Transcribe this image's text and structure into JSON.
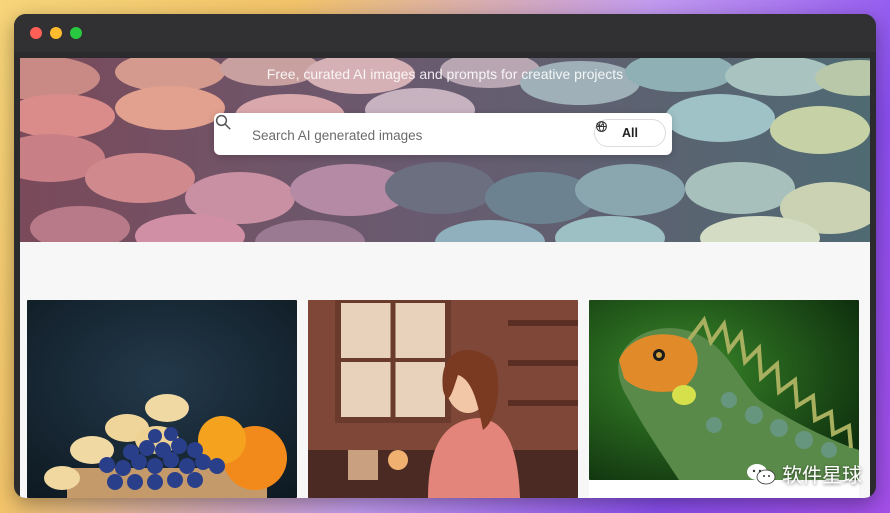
{
  "hero": {
    "tagline": "Free, curated AI images and prompts for creative projects"
  },
  "search": {
    "placeholder": "Search AI generated images",
    "filter_label": "All"
  },
  "gallery": {
    "items": [
      {
        "subject": "blueberries-banana-toast-photo"
      },
      {
        "subject": "woman-at-window-photo"
      },
      {
        "subject": "iguana-photo"
      }
    ]
  },
  "watermark": {
    "text": "软件星球"
  }
}
